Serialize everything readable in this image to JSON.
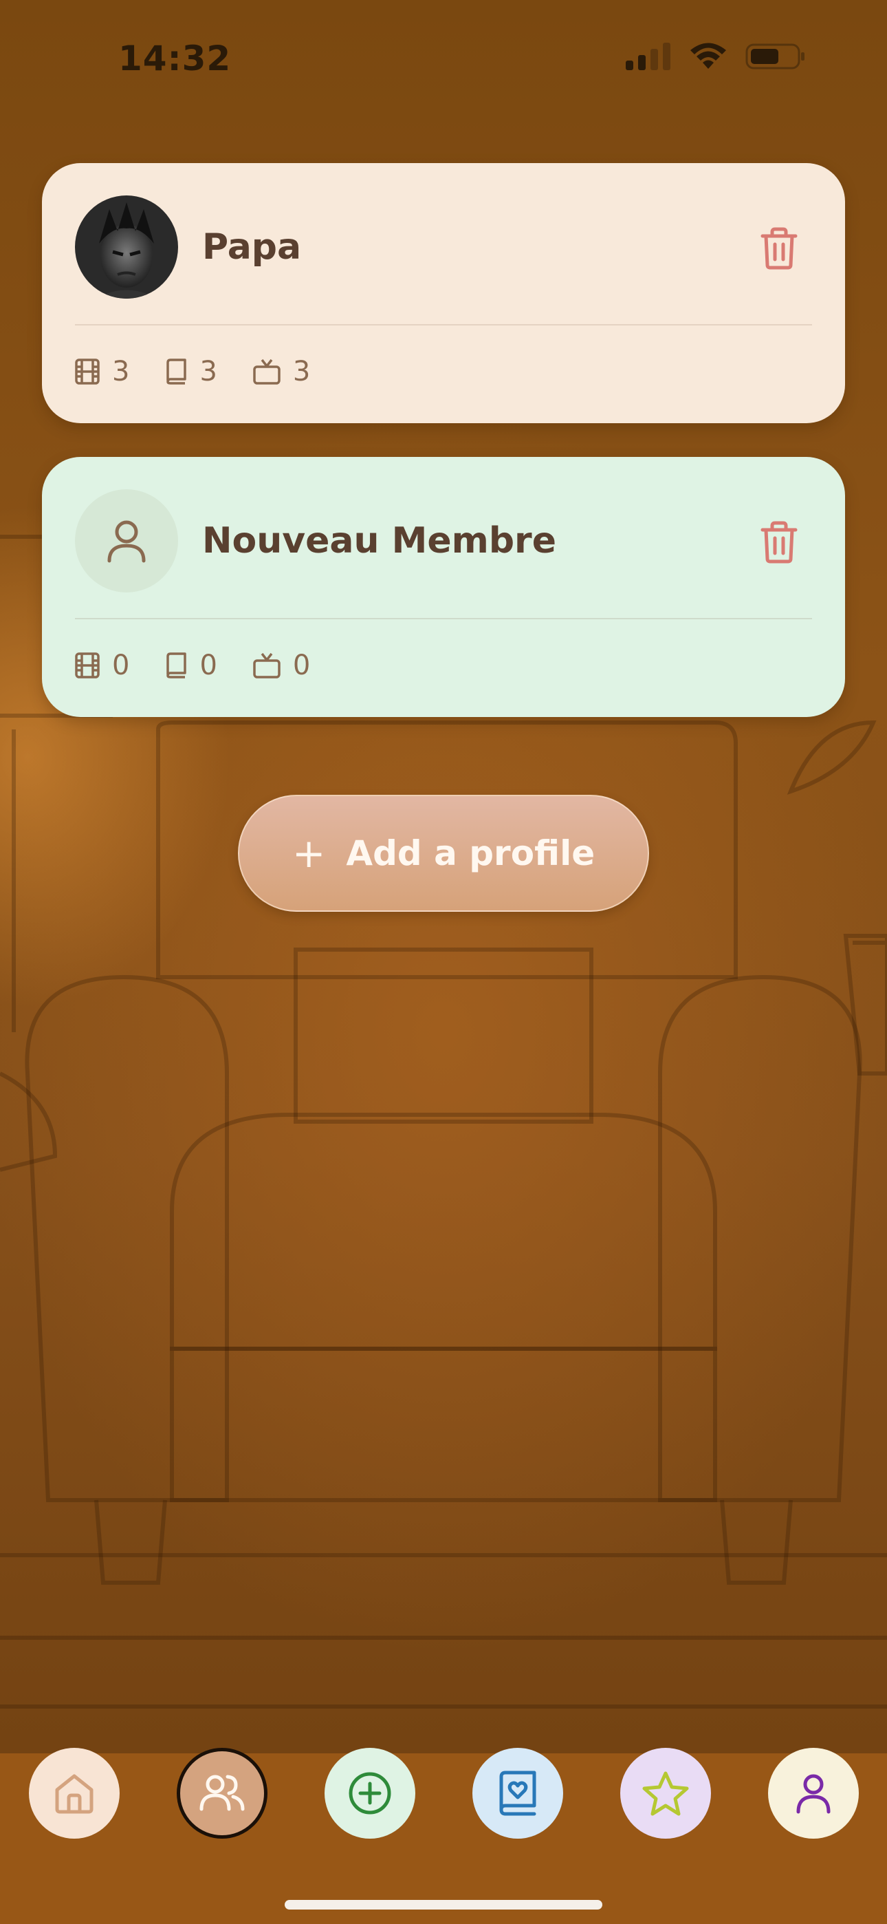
{
  "status_bar": {
    "time": "14:32",
    "icons": [
      "signal-icon",
      "wifi-icon",
      "battery-icon"
    ]
  },
  "profiles": [
    {
      "name": "Papa",
      "avatar": "avatar-photo",
      "stats": {
        "movies": "3",
        "books": "3",
        "tv_shows": "3"
      },
      "card_color": "#f8e9da"
    },
    {
      "name": "Nouveau Membre",
      "avatar": "person-icon",
      "stats": {
        "movies": "0",
        "books": "0",
        "tv_shows": "0"
      },
      "card_color": "#dff3e4"
    }
  ],
  "add_button": {
    "icon": "+",
    "label": "Add a profile"
  },
  "tab_bar": {
    "tabs": [
      {
        "name": "home",
        "icon": "home-icon",
        "color": "#f8e4d4",
        "active": false
      },
      {
        "name": "profiles",
        "icon": "users-icon",
        "color": "#d4a37f",
        "active": true
      },
      {
        "name": "add",
        "icon": "plus-circle-icon",
        "color": "#dff3e4",
        "active": false
      },
      {
        "name": "library",
        "icon": "book-heart-icon",
        "color": "#d7e9f7",
        "active": false
      },
      {
        "name": "favorites",
        "icon": "star-icon",
        "color": "#e9dcf5",
        "active": false
      },
      {
        "name": "account",
        "icon": "person-icon",
        "color": "#f8f2dc",
        "active": false
      }
    ]
  },
  "colors": {
    "accent_trash": "#d97a72",
    "text_dark": "#5a4030",
    "tab_bar_bg": "#985716"
  }
}
